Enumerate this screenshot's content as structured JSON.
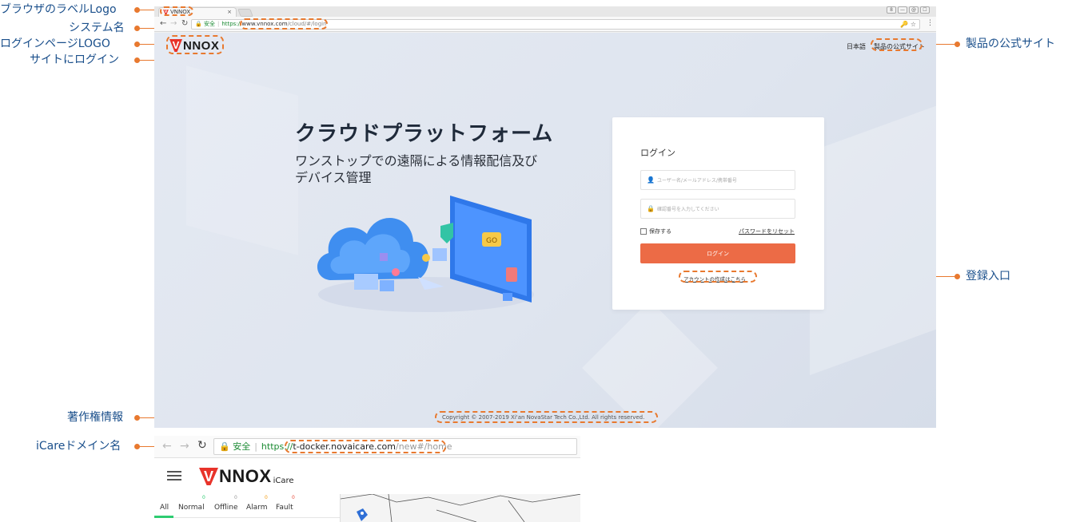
{
  "annotations": {
    "browser_tab_logo": "ブラウザのラベルLogo",
    "system_name": "システム名",
    "login_page_logo": "ログインページLOGO",
    "site_login": "サイトにログイン",
    "official_site": "製品の公式サイト",
    "registration_entry": "登録入口",
    "copyright_info": "著作権情報",
    "icare_domain": "iCareドメイン名"
  },
  "browser": {
    "tab": {
      "title": "VNNOX",
      "close": "×"
    },
    "window_controls": [
      "8",
      "—",
      "@",
      "☐"
    ],
    "address": {
      "secure_label": "安全",
      "protocol": "https://",
      "domain": "www.vnnox.com",
      "path": "/cloud/#/login"
    }
  },
  "page": {
    "logo": {
      "mark": "V",
      "text": "NNOX"
    },
    "header": {
      "language": "日本語",
      "official_site": "製品の公式サイト"
    },
    "hero": {
      "title": "クラウドプラットフォーム",
      "subtitle_line1": "ワンストップでの遠隔による情報配信及び",
      "subtitle_line2": "デバイス管理"
    },
    "illustration": {
      "badge_text": "GO"
    },
    "login": {
      "title": "ログイン",
      "username_placeholder": "ユーザー名/メールアドレス/携帯番号",
      "password_placeholder": "確認番号を入力してください",
      "remember_label": "保存する",
      "reset_link": "パスワードをリセット",
      "submit_label": "ログイン",
      "create_account": "アカウントの作成はこちら"
    },
    "copyright": "Copyright © 2007-2019 Xi'an NovaStar Tech Co.,Ltd. All rights reserved."
  },
  "icare": {
    "address": {
      "secure_label": "安全",
      "protocol": "https://",
      "domain": "t-docker.novaicare.com",
      "path": "/new#/home"
    },
    "logo": {
      "mark": "V",
      "text": "NNOX",
      "suffix": "iCare"
    },
    "tabs": [
      {
        "label": "All",
        "count": ""
      },
      {
        "label": "Normal",
        "count": "0"
      },
      {
        "label": "Offline",
        "count": "0"
      },
      {
        "label": "Alarm",
        "count": "0"
      },
      {
        "label": "Fault",
        "count": "0"
      }
    ]
  },
  "colors": {
    "annotation": "#e8792f",
    "annotation_text": "#1a4f8b",
    "login_button": "#ec6b46",
    "brand_red": "#e8332a",
    "normal_count": "#2ecc71",
    "offline_count": "#999999",
    "alarm_count": "#f39c12",
    "fault_count": "#e74c3c"
  }
}
